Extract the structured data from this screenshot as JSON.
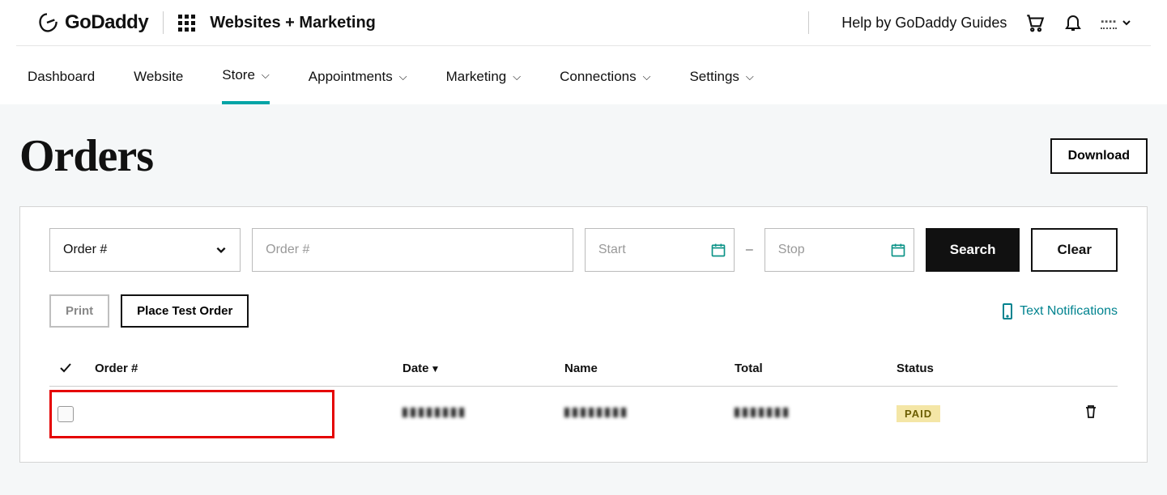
{
  "header": {
    "brand": "GoDaddy",
    "product": "Websites + Marketing",
    "help_text": "Help by GoDaddy Guides"
  },
  "nav": {
    "items": [
      {
        "label": "Dashboard",
        "has_caret": false
      },
      {
        "label": "Website",
        "has_caret": false
      },
      {
        "label": "Store",
        "has_caret": true,
        "active": true
      },
      {
        "label": "Appointments",
        "has_caret": true
      },
      {
        "label": "Marketing",
        "has_caret": true
      },
      {
        "label": "Connections",
        "has_caret": true
      },
      {
        "label": "Settings",
        "has_caret": true
      }
    ]
  },
  "page": {
    "title": "Orders",
    "download_label": "Download"
  },
  "filters": {
    "select_label": "Order #",
    "search_placeholder": "Order #",
    "start_placeholder": "Start",
    "stop_placeholder": "Stop",
    "search_btn": "Search",
    "clear_btn": "Clear"
  },
  "actions": {
    "print_btn": "Print",
    "test_order_btn": "Place Test Order",
    "text_notifications": "Text Notifications"
  },
  "table": {
    "headers": {
      "order": "Order #",
      "date": "Date",
      "name": "Name",
      "total": "Total",
      "status": "Status"
    },
    "rows": [
      {
        "order": "(redacted)",
        "date": "(redacted)",
        "name": "(redacted)",
        "total": "(redacted)",
        "status": "PAID"
      }
    ]
  }
}
